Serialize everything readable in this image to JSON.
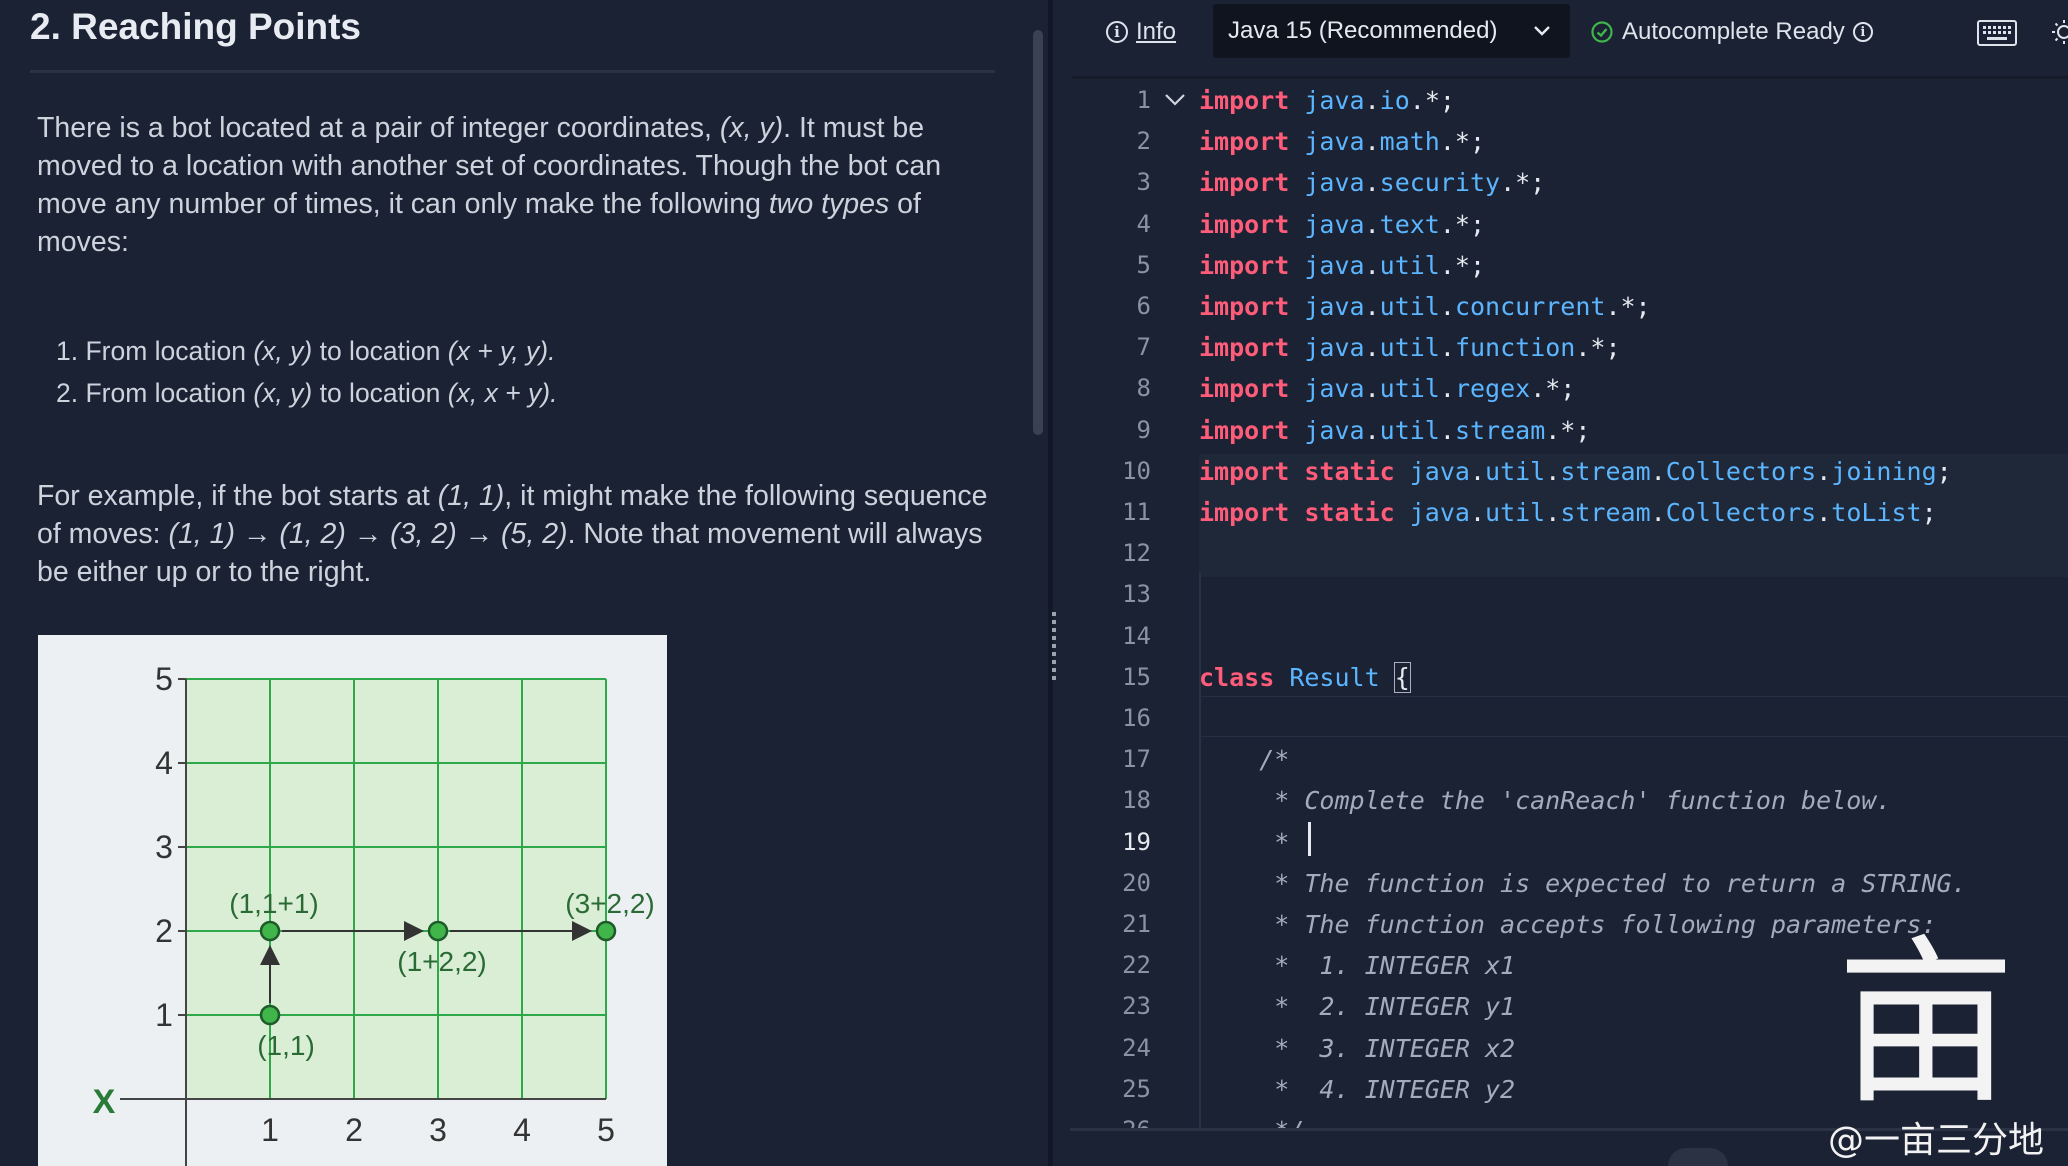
{
  "problem": {
    "title": "2. Reaching Points",
    "p1": [
      {
        "t": "There is a bot located at a pair of integer coordinates, "
      },
      {
        "t": "(x, y)",
        "i": true
      },
      {
        "t": ". It must be moved to a location with another set of coordinates. Though the bot can move any number of times, it can only make the following "
      },
      {
        "t": "two types",
        "i": true
      },
      {
        "t": " of moves:"
      }
    ],
    "moves": [
      [
        {
          "t": "1. From location "
        },
        {
          "t": "(x, y)",
          "i": true
        },
        {
          "t": " to location "
        },
        {
          "t": "(x + y, y).",
          "i": true
        }
      ],
      [
        {
          "t": "2. From location "
        },
        {
          "t": "(x, y)",
          "i": true
        },
        {
          "t": " to location "
        },
        {
          "t": "(x, x + y).",
          "i": true
        }
      ]
    ],
    "p2": [
      {
        "t": "For example, if the bot starts at "
      },
      {
        "t": "(1, 1)",
        "i": true
      },
      {
        "t": ", it might make the following sequence of moves: "
      },
      {
        "t": "(1, 1) → (1, 2) → (3, 2) → (5, 2)",
        "i": true
      },
      {
        "t": ". Note that movement will always be either up or to the right."
      }
    ]
  },
  "chart_data": {
    "type": "scatter",
    "title": "",
    "xlabel": "X",
    "ylabel": "",
    "xlim": [
      0,
      5
    ],
    "ylim": [
      0,
      5
    ],
    "x_ticks": [
      "1",
      "2",
      "3",
      "4",
      "5"
    ],
    "y_ticks": [
      "1",
      "2",
      "3",
      "4",
      "5"
    ],
    "grid": true,
    "points": [
      {
        "x": 1,
        "y": 1,
        "label": "(1,1)",
        "label_pos": "below"
      },
      {
        "x": 1,
        "y": 2,
        "label": "(1,1+1)",
        "label_pos": "above"
      },
      {
        "x": 3,
        "y": 2,
        "label": "(1+2,2)",
        "label_pos": "below"
      },
      {
        "x": 5,
        "y": 2,
        "label": "(3+2,2)",
        "label_pos": "above"
      }
    ],
    "arrows": [
      {
        "from": [
          1,
          1
        ],
        "to": [
          1,
          2
        ]
      },
      {
        "from": [
          1,
          2
        ],
        "to": [
          3,
          2
        ]
      },
      {
        "from": [
          3,
          2
        ],
        "to": [
          5,
          2
        ]
      }
    ],
    "colors": {
      "grid": "#2fa84a",
      "fill": "#d9eed5",
      "point": "#3fb54a"
    }
  },
  "toolbar": {
    "info_label": "Info",
    "language": "Java 15 (Recommended)",
    "autocomplete_status": "Autocomplete Ready"
  },
  "editor": {
    "current_line": 19,
    "lines": [
      [
        [
          "kw",
          "import"
        ],
        [
          "pl",
          " "
        ],
        [
          "id",
          "java"
        ],
        [
          "pl",
          "."
        ],
        [
          "id",
          "io"
        ],
        [
          "pl",
          ".*;"
        ]
      ],
      [
        [
          "kw",
          "import"
        ],
        [
          "pl",
          " "
        ],
        [
          "id",
          "java"
        ],
        [
          "pl",
          "."
        ],
        [
          "id",
          "math"
        ],
        [
          "pl",
          ".*;"
        ]
      ],
      [
        [
          "kw",
          "import"
        ],
        [
          "pl",
          " "
        ],
        [
          "id",
          "java"
        ],
        [
          "pl",
          "."
        ],
        [
          "id",
          "security"
        ],
        [
          "pl",
          ".*;"
        ]
      ],
      [
        [
          "kw",
          "import"
        ],
        [
          "pl",
          " "
        ],
        [
          "id",
          "java"
        ],
        [
          "pl",
          "."
        ],
        [
          "id",
          "text"
        ],
        [
          "pl",
          ".*;"
        ]
      ],
      [
        [
          "kw",
          "import"
        ],
        [
          "pl",
          " "
        ],
        [
          "id",
          "java"
        ],
        [
          "pl",
          "."
        ],
        [
          "id",
          "util"
        ],
        [
          "pl",
          ".*;"
        ]
      ],
      [
        [
          "kw",
          "import"
        ],
        [
          "pl",
          " "
        ],
        [
          "id",
          "java"
        ],
        [
          "pl",
          "."
        ],
        [
          "id",
          "util"
        ],
        [
          "pl",
          "."
        ],
        [
          "id",
          "concurrent"
        ],
        [
          "pl",
          ".*;"
        ]
      ],
      [
        [
          "kw",
          "import"
        ],
        [
          "pl",
          " "
        ],
        [
          "id",
          "java"
        ],
        [
          "pl",
          "."
        ],
        [
          "id",
          "util"
        ],
        [
          "pl",
          "."
        ],
        [
          "id",
          "function"
        ],
        [
          "pl",
          ".*;"
        ]
      ],
      [
        [
          "kw",
          "import"
        ],
        [
          "pl",
          " "
        ],
        [
          "id",
          "java"
        ],
        [
          "pl",
          "."
        ],
        [
          "id",
          "util"
        ],
        [
          "pl",
          "."
        ],
        [
          "id",
          "regex"
        ],
        [
          "pl",
          ".*;"
        ]
      ],
      [
        [
          "kw",
          "import"
        ],
        [
          "pl",
          " "
        ],
        [
          "id",
          "java"
        ],
        [
          "pl",
          "."
        ],
        [
          "id",
          "util"
        ],
        [
          "pl",
          "."
        ],
        [
          "id",
          "stream"
        ],
        [
          "pl",
          ".*;"
        ]
      ],
      [
        [
          "kw",
          "import"
        ],
        [
          "pl",
          " "
        ],
        [
          "kw",
          "static"
        ],
        [
          "pl",
          " "
        ],
        [
          "id",
          "java"
        ],
        [
          "pl",
          "."
        ],
        [
          "id",
          "util"
        ],
        [
          "pl",
          "."
        ],
        [
          "id",
          "stream"
        ],
        [
          "pl",
          "."
        ],
        [
          "id",
          "Collectors"
        ],
        [
          "pl",
          "."
        ],
        [
          "id",
          "joining"
        ],
        [
          "pl",
          ";"
        ]
      ],
      [
        [
          "kw",
          "import"
        ],
        [
          "pl",
          " "
        ],
        [
          "kw",
          "static"
        ],
        [
          "pl",
          " "
        ],
        [
          "id",
          "java"
        ],
        [
          "pl",
          "."
        ],
        [
          "id",
          "util"
        ],
        [
          "pl",
          "."
        ],
        [
          "id",
          "stream"
        ],
        [
          "pl",
          "."
        ],
        [
          "id",
          "Collectors"
        ],
        [
          "pl",
          "."
        ],
        [
          "id",
          "toList"
        ],
        [
          "pl",
          ";"
        ]
      ],
      [],
      [],
      [],
      [
        [
          "kw",
          "class"
        ],
        [
          "pl",
          " "
        ],
        [
          "id",
          "Result"
        ],
        [
          "pl",
          " "
        ],
        [
          "brace",
          "{"
        ]
      ],
      [],
      [
        [
          "cm",
          "    /*"
        ]
      ],
      [
        [
          "cm",
          "     * Complete the 'canReach' function below."
        ]
      ],
      [
        [
          "cm",
          "     *"
        ]
      ],
      [
        [
          "cm",
          "     * The function is expected to return a STRING."
        ]
      ],
      [
        [
          "cm",
          "     * The function accepts following parameters:"
        ]
      ],
      [
        [
          "cm",
          "     *  1. INTEGER x1"
        ]
      ],
      [
        [
          "cm",
          "     *  2. INTEGER y1"
        ]
      ],
      [
        [
          "cm",
          "     *  3. INTEGER x2"
        ]
      ],
      [
        [
          "cm",
          "     *  4. INTEGER y2"
        ]
      ],
      [
        [
          "cm",
          "     */"
        ]
      ]
    ]
  },
  "watermark": {
    "glyph": "亩",
    "text": "@一亩三分地"
  }
}
